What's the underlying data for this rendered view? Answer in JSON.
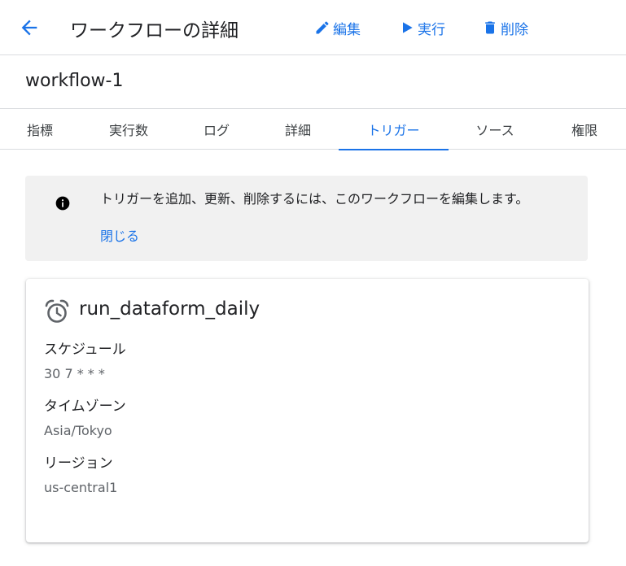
{
  "header": {
    "title": "ワークフローの詳細",
    "back_icon": "arrow-back-icon",
    "actions": {
      "edit": {
        "label": "編集",
        "icon": "pencil-icon"
      },
      "run": {
        "label": "実行",
        "icon": "play-icon"
      },
      "delete": {
        "label": "削除",
        "icon": "trash-icon"
      }
    }
  },
  "workflow": {
    "name": "workflow-1"
  },
  "tabs": [
    {
      "label": "指標",
      "active": false
    },
    {
      "label": "実行数",
      "active": false
    },
    {
      "label": "ログ",
      "active": false
    },
    {
      "label": "詳細",
      "active": false
    },
    {
      "label": "トリガー",
      "active": true
    },
    {
      "label": "ソース",
      "active": false
    },
    {
      "label": "権限",
      "active": false
    }
  ],
  "banner": {
    "icon": "info-icon",
    "message": "トリガーを追加、更新、削除するには、このワークフローを編集します。",
    "close_label": "閉じる"
  },
  "trigger": {
    "icon": "alarm-clock-icon",
    "name": "run_dataform_daily",
    "fields": [
      {
        "label": "スケジュール",
        "value": "30 7 * * *"
      },
      {
        "label": "タイムゾーン",
        "value": "Asia/Tokyo"
      },
      {
        "label": "リージョン",
        "value": "us-central1"
      }
    ]
  },
  "colors": {
    "accent": "#1a73e8",
    "banner_bg": "#f1f1f1",
    "text": "#202124",
    "muted": "#5f6368"
  }
}
